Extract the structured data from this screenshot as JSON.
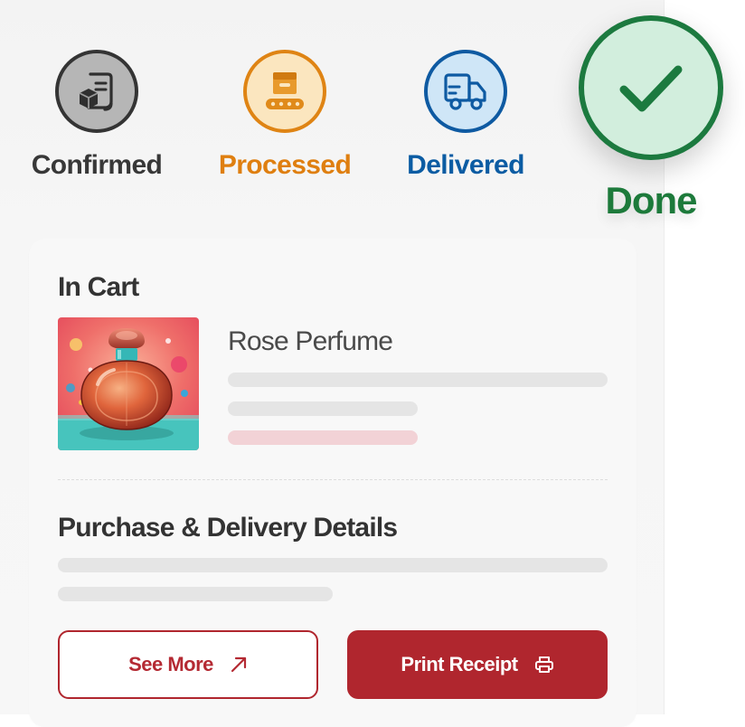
{
  "tracker": {
    "steps": [
      {
        "label": "Confirmed",
        "icon": "receipt-package-icon",
        "color": "#383838"
      },
      {
        "label": "Processed",
        "icon": "conveyor-box-icon",
        "color": "#df7f10"
      },
      {
        "label": "Delivered",
        "icon": "delivery-truck-icon",
        "color": "#0b5ca3"
      }
    ],
    "done": {
      "label": "Done",
      "icon": "checkmark-icon",
      "color": "#1d7a3b"
    }
  },
  "cart": {
    "title": "In Cart",
    "product": {
      "name": "Rose Perfume",
      "image": "rose-perfume-bottle-image"
    }
  },
  "details": {
    "title": "Purchase & Delivery Details"
  },
  "actions": {
    "see_more_label": "See More",
    "see_more_icon": "arrow-up-right-icon",
    "print_label": "Print Receipt",
    "print_icon": "printer-icon"
  },
  "colors": {
    "accent": "#b0262e",
    "success": "#1c7a3f"
  }
}
